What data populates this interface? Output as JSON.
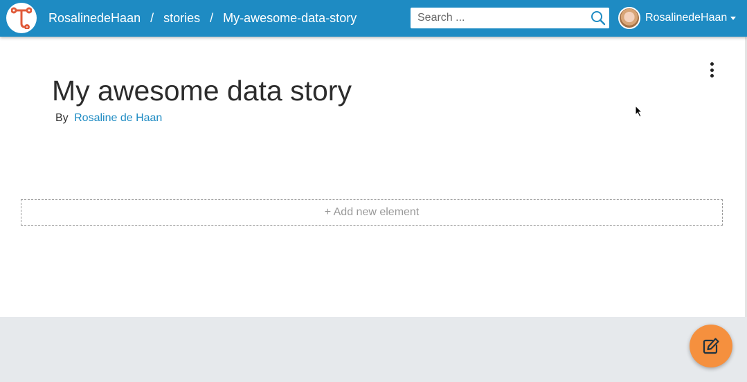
{
  "header": {
    "logo_icon": "t-logo-icon",
    "breadcrumb": [
      "RosalinedeHaan",
      "stories",
      "My-awesome-data-story"
    ],
    "separator": "/",
    "search": {
      "placeholder": "Search ...",
      "value": "",
      "icon": "search-icon"
    },
    "user": {
      "name": "RosalinedeHaan",
      "avatar": "user-avatar",
      "dropdown_icon": "caret-down-icon"
    }
  },
  "story": {
    "title": "My awesome data story",
    "by_label": "By",
    "author": "Rosaline de Haan",
    "add_element_label": "+ Add new element",
    "menu_icon": "kebab-menu-icon"
  },
  "fab": {
    "icon": "edit-icon"
  },
  "colors": {
    "brand": "#1e8bc3",
    "fab": "#f5903e",
    "logo_accent": "#e05a3a",
    "footer_bg": "#e6e9ec"
  }
}
